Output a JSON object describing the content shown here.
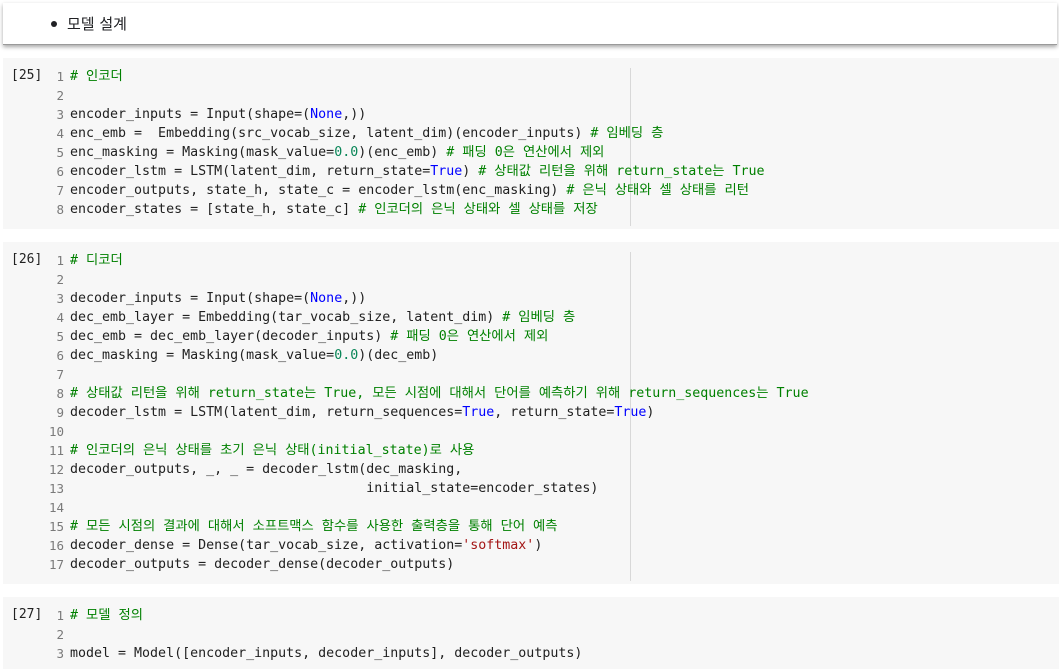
{
  "heading_bullet": "모델 설계",
  "cells": [
    {
      "exec_label": "[25]",
      "lines": [
        [
          {
            "t": "# 인코더",
            "c": "com"
          }
        ],
        [],
        [
          {
            "t": "encoder_inputs = Input(shape=("
          },
          {
            "t": "None",
            "c": "kw"
          },
          {
            "t": ",))"
          }
        ],
        [
          {
            "t": "enc_emb =  Embedding(src_vocab_size, latent_dim)(encoder_inputs) "
          },
          {
            "t": "# 임베딩 층",
            "c": "com"
          }
        ],
        [
          {
            "t": "enc_masking = Masking(mask_value="
          },
          {
            "t": "0.0",
            "c": "num"
          },
          {
            "t": ")(enc_emb) "
          },
          {
            "t": "# 패딩 0은 연산에서 제외",
            "c": "com"
          }
        ],
        [
          {
            "t": "encoder_lstm = LSTM(latent_dim, return_state="
          },
          {
            "t": "True",
            "c": "kw"
          },
          {
            "t": ") "
          },
          {
            "t": "# 상태값 리턴을 위해 return_state는 True",
            "c": "com"
          }
        ],
        [
          {
            "t": "encoder_outputs, state_h, state_c = encoder_lstm(enc_masking) "
          },
          {
            "t": "# 은닉 상태와 셀 상태를 리턴",
            "c": "com"
          }
        ],
        [
          {
            "t": "encoder_states = [state_h, state_c] "
          },
          {
            "t": "# 인코더의 은닉 상태와 셀 상태를 저장",
            "c": "com"
          }
        ]
      ]
    },
    {
      "exec_label": "[26]",
      "lines": [
        [
          {
            "t": "# 디코더",
            "c": "com"
          }
        ],
        [],
        [
          {
            "t": "decoder_inputs = Input(shape=("
          },
          {
            "t": "None",
            "c": "kw"
          },
          {
            "t": ",))"
          }
        ],
        [
          {
            "t": "dec_emb_layer = Embedding(tar_vocab_size, latent_dim) "
          },
          {
            "t": "# 임베딩 층",
            "c": "com"
          }
        ],
        [
          {
            "t": "dec_emb = dec_emb_layer(decoder_inputs) "
          },
          {
            "t": "# 패딩 0은 연산에서 제외",
            "c": "com"
          }
        ],
        [
          {
            "t": "dec_masking = Masking(mask_value="
          },
          {
            "t": "0.0",
            "c": "num"
          },
          {
            "t": ")(dec_emb)"
          }
        ],
        [],
        [
          {
            "t": "# 상태값 리턴을 위해 return_state는 True, 모든 시점에 대해서 단어를 예측하기 위해 return_sequences는 True",
            "c": "com"
          }
        ],
        [
          {
            "t": "decoder_lstm = LSTM(latent_dim, return_sequences="
          },
          {
            "t": "True",
            "c": "kw"
          },
          {
            "t": ", return_state="
          },
          {
            "t": "True",
            "c": "kw"
          },
          {
            "t": ")"
          }
        ],
        [],
        [
          {
            "t": "# 인코더의 은닉 상태를 초기 은닉 상태(initial_state)로 사용",
            "c": "com"
          }
        ],
        [
          {
            "t": "decoder_outputs, _, _ = decoder_lstm(dec_masking,"
          }
        ],
        [
          {
            "t": "                                     initial_state=encoder_states)"
          }
        ],
        [],
        [
          {
            "t": "# 모든 시점의 결과에 대해서 소프트맥스 함수를 사용한 출력층을 통해 단어 예측",
            "c": "com"
          }
        ],
        [
          {
            "t": "decoder_dense = Dense(tar_vocab_size, activation="
          },
          {
            "t": "'softmax'",
            "c": "str"
          },
          {
            "t": ")"
          }
        ],
        [
          {
            "t": "decoder_outputs = decoder_dense(decoder_outputs)"
          }
        ]
      ]
    },
    {
      "exec_label": "[27]",
      "lines": [
        [
          {
            "t": "# 모델 정의",
            "c": "com"
          }
        ],
        [],
        [
          {
            "t": "model = Model([encoder_inputs, decoder_inputs], decoder_outputs)"
          }
        ]
      ]
    }
  ]
}
